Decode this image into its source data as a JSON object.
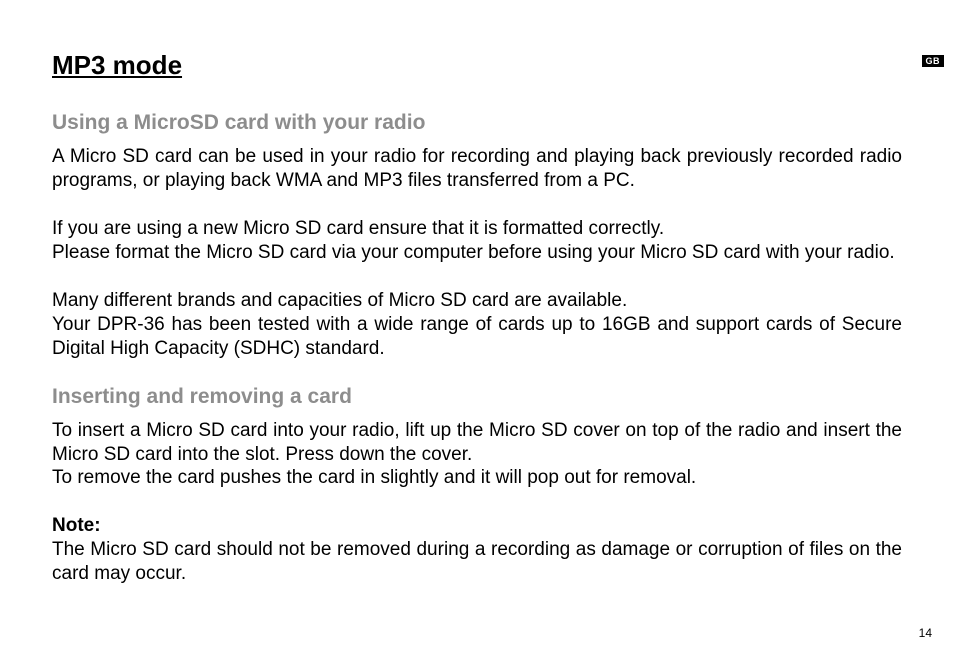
{
  "lang_badge": "GB",
  "page_number": "14",
  "title": "MP3 mode",
  "section1": {
    "heading": "Using a MicroSD card with your radio",
    "p1": "A Micro SD card can be used in your radio for recording and playing back previously recorded radio programs, or playing back WMA and MP3 files transferred from a PC.",
    "p2": "If you are using a new Micro SD card ensure that it is formatted correctly.\nPlease format the Micro SD card via your computer before using your Micro SD card with your radio.",
    "p3": "Many different brands and capacities of Micro SD card are available.\nYour DPR-36 has been tested with a wide range of cards up to 16GB and support cards of Secure Digital High Capacity (SDHC) standard."
  },
  "section2": {
    "heading": "Inserting and removing a card",
    "p1": "To insert a Micro SD card into your radio, lift up the Micro SD cover on top of the radio and insert the Micro SD card into the slot. Press down the cover.\nTo remove the card pushes the card in slightly and it will pop out for removal.",
    "note_label": "Note:",
    "note_text": "The Micro SD card should not be removed during a recording as damage or corruption of files on the card may occur."
  }
}
